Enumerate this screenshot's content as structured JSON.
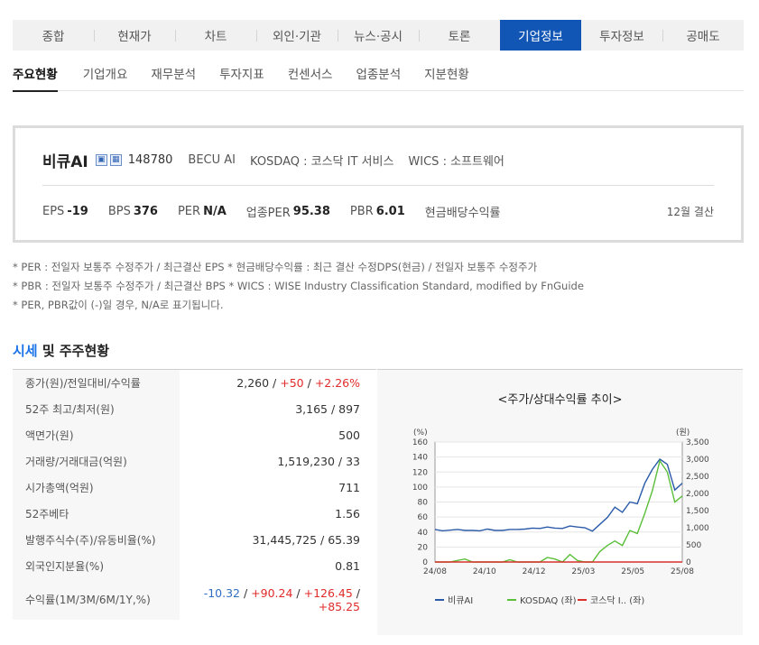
{
  "top_tabs": [
    "종합",
    "현재가",
    "차트",
    "외인·기관",
    "뉴스·공시",
    "토론",
    "기업정보",
    "투자정보",
    "공매도"
  ],
  "active_top_tab": "기업정보",
  "sub_tabs": [
    "주요현황",
    "기업개요",
    "재무분석",
    "투자지표",
    "컨센서스",
    "업종분석",
    "지분현황"
  ],
  "active_sub_tab": "주요현황",
  "company": {
    "name": "비큐AI",
    "badge_icons": [
      "building-icon",
      "chart-doc-icon"
    ],
    "code": "148780",
    "english_name": "BECU AI",
    "market": "KOSDAQ : 코스닥 IT 서비스",
    "wics": "WICS : 소프트웨어",
    "eps_label": "EPS",
    "eps": "-19",
    "bps_label": "BPS",
    "bps": "376",
    "per_label": "PER",
    "per": "N/A",
    "sector_per_label": "업종PER",
    "sector_per": "95.38",
    "pbr_label": "PBR",
    "pbr": "6.01",
    "dividend_label": "현금배당수익률",
    "fiscal": "12월 결산"
  },
  "notes": [
    "* PER : 전일자 보통주 수정주가 / 최근결산 EPS * 현금배당수익률 : 최근 결산 수정DPS(현금) / 전일자 보통주 수정주가",
    "* PBR : 전일자 보통주 수정주가 / 최근결산 BPS * WICS : WISE Industry Classification Standard, modified by FnGuide",
    "* PER, PBR값이 (-)일 경우, N/A로 표기됩니다."
  ],
  "section": {
    "title_highlight": "시세",
    "title_rest": " 및 주주현황"
  },
  "stats": {
    "price_label": "종가(원)/전일대비/수익률",
    "price": "2,260",
    "sep1": " / ",
    "change": "+50",
    "sep2": " / ",
    "change_pct": "+2.26%",
    "range_label": "52주 최고/최저(원)",
    "range": "3,165 / 897",
    "par_label": "액면가(원)",
    "par": "500",
    "volume_label": "거래량/거래대금(억원)",
    "volume": "1,519,230 / 33",
    "mcap_label": "시가총액(억원)",
    "mcap": "711",
    "beta_label": "52주베타",
    "beta": "1.56",
    "shares_label": "발행주식수(주)/유동비율(%)",
    "shares": "31,445,725 / 65.39",
    "foreign_label": "외국인지분율(%)",
    "foreign": "0.81",
    "returns_label": "수익률(1M/3M/6M/1Y,%)",
    "ret_1m": "-10.32",
    "ret_3m": "+90.24",
    "ret_6m": "+126.45",
    "ret_1y": "+85.25",
    "ret_sep": " / "
  },
  "chart_data": {
    "type": "line",
    "title": "<주가/상대수익률 추이>",
    "x": [
      "24/08",
      "24/10",
      "24/12",
      "25/03",
      "25/05",
      "25/08"
    ],
    "left_axis": {
      "unit": "(%)",
      "ylim": [
        0,
        160
      ],
      "ticks": [
        "0",
        "20",
        "40",
        "60",
        "80",
        "100",
        "120",
        "140",
        "160"
      ]
    },
    "right_axis": {
      "unit": "(원)",
      "ylim": [
        0,
        3500
      ],
      "ticks": [
        "0",
        "500",
        "1,000",
        "1,500",
        "2,000",
        "2,500",
        "3,000",
        "3,500"
      ]
    },
    "grid": true,
    "legend_position": "bottom",
    "series": [
      {
        "name": "비큐AI",
        "color": "#2a5aa8",
        "axis": "right",
        "values": [
          950,
          910,
          930,
          950,
          920,
          920,
          910,
          960,
          920,
          920,
          950,
          950,
          960,
          990,
          980,
          1020,
          990,
          980,
          1050,
          1020,
          1000,
          900,
          1100,
          1300,
          1600,
          1450,
          1750,
          1700,
          2300,
          2700,
          3000,
          2850,
          2100,
          2300
        ]
      },
      {
        "name": "KOSDAQ (좌)",
        "color": "#5bbf3a",
        "axis": "left",
        "values": [
          0,
          0,
          -2,
          2,
          4,
          0,
          -2,
          -3,
          -2,
          0,
          3,
          0,
          -3,
          -2,
          -2,
          6,
          4,
          0,
          10,
          2,
          0,
          0,
          14,
          22,
          28,
          22,
          42,
          38,
          65,
          95,
          135,
          120,
          80,
          88
        ]
      },
      {
        "name": "코스닥 I.. (좌)",
        "color": "#d9302c",
        "axis": "left",
        "values": [
          0,
          0,
          0,
          0,
          0,
          0,
          0,
          0,
          0,
          0,
          0,
          0,
          0,
          0,
          0,
          0,
          0,
          0,
          0,
          0,
          0,
          0,
          0,
          0,
          0,
          0,
          0,
          0,
          0,
          0,
          0,
          0,
          0,
          0
        ]
      }
    ]
  }
}
